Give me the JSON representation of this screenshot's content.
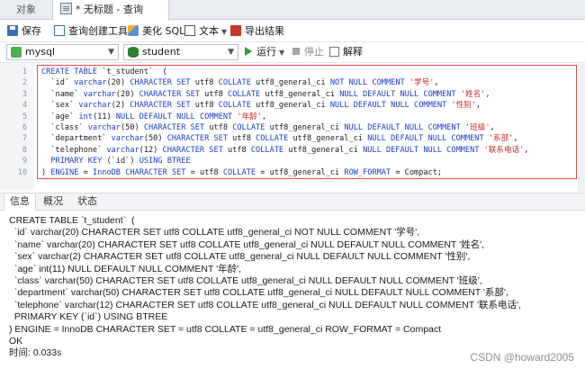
{
  "tabs": {
    "objects": "对象",
    "query": "* 无标题 - 查询"
  },
  "toolbar": {
    "save": "保存",
    "query_builder": "查询创建工具",
    "beautify": "美化 SQL",
    "text": "文本",
    "export": "导出结果"
  },
  "connection": {
    "conn_value": "mysql",
    "db_value": "student",
    "run": "运行",
    "stop": "停止",
    "explain": "解释"
  },
  "editor": {
    "lines": [
      {
        "n": "1",
        "t": "CREATE TABLE `t_student`  ("
      },
      {
        "n": "2",
        "t": "  `id` varchar(20) CHARACTER SET utf8 COLLATE utf8_general_ci NOT NULL COMMENT '学号',"
      },
      {
        "n": "3",
        "t": "  `name` varchar(20) CHARACTER SET utf8 COLLATE utf8_general_ci NULL DEFAULT NULL COMMENT '姓名',"
      },
      {
        "n": "4",
        "t": "  `sex` varchar(2) CHARACTER SET utf8 COLLATE utf8_general_ci NULL DEFAULT NULL COMMENT '性别',"
      },
      {
        "n": "5",
        "t": "  `age` int(11) NULL DEFAULT NULL COMMENT '年龄',"
      },
      {
        "n": "6",
        "t": "  `class` varchar(50) CHARACTER SET utf8 COLLATE utf8_general_ci NULL DEFAULT NULL COMMENT '班级',"
      },
      {
        "n": "7",
        "t": "  `department` varchar(50) CHARACTER SET utf8 COLLATE utf8_general_ci NULL DEFAULT NULL COMMENT '系部',"
      },
      {
        "n": "8",
        "t": "  `telephone` varchar(12) CHARACTER SET utf8 COLLATE utf8_general_ci NULL DEFAULT NULL COMMENT '联系电话',"
      },
      {
        "n": "9",
        "t": "  PRIMARY KEY (`id`) USING BTREE"
      },
      {
        "n": "10",
        "t": ") ENGINE = InnoDB CHARACTER SET = utf8 COLLATE = utf8_general_ci ROW_FORMAT = Compact;"
      }
    ]
  },
  "bottom_tabs": {
    "info": "信息",
    "summary": "概况",
    "status": "状态"
  },
  "output": {
    "lines": [
      "CREATE TABLE `t_student`  (",
      "  `id` varchar(20) CHARACTER SET utf8 COLLATE utf8_general_ci NOT NULL COMMENT '学号',",
      "  `name` varchar(20) CHARACTER SET utf8 COLLATE utf8_general_ci NULL DEFAULT NULL COMMENT '姓名',",
      "  `sex` varchar(2) CHARACTER SET utf8 COLLATE utf8_general_ci NULL DEFAULT NULL COMMENT '性别',",
      "  `age` int(11) NULL DEFAULT NULL COMMENT '年龄',",
      "  `class` varchar(50) CHARACTER SET utf8 COLLATE utf8_general_ci NULL DEFAULT NULL COMMENT '班级',",
      "  `department` varchar(50) CHARACTER SET utf8 COLLATE utf8_general_ci NULL DEFAULT NULL COMMENT '系部',",
      "  `telephone` varchar(12) CHARACTER SET utf8 COLLATE utf8_general_ci NULL DEFAULT NULL COMMENT '联系电话',",
      "  PRIMARY KEY (`id`) USING BTREE",
      ") ENGINE = InnoDB CHARACTER SET = utf8 COLLATE = utf8_general_ci ROW_FORMAT = Compact",
      "OK",
      "时间: 0.033s"
    ]
  },
  "watermark": "CSDN @howard2005",
  "colors": {
    "keyword": "#1b3ec0",
    "string": "#c62828",
    "frame": "#e04a4a"
  }
}
